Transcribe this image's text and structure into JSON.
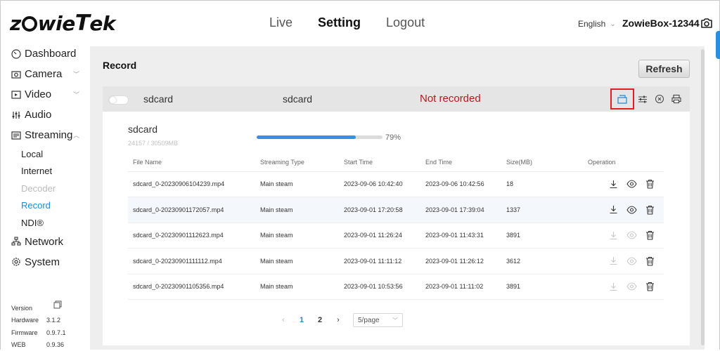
{
  "brand": {
    "logo_text": "ZowieTek"
  },
  "topnav": [
    {
      "label": "Live"
    },
    {
      "label": "Setting"
    },
    {
      "label": "Logout"
    }
  ],
  "header": {
    "language": "English",
    "device_name": "ZowieBox-12344"
  },
  "sidebar": {
    "items": [
      {
        "label": "Dashboard",
        "icon": "dashboard-icon"
      },
      {
        "label": "Camera",
        "icon": "camera-icon"
      },
      {
        "label": "Video",
        "icon": "video-icon"
      },
      {
        "label": "Audio",
        "icon": "audio-icon"
      },
      {
        "label": "Streaming",
        "icon": "streaming-icon"
      }
    ],
    "streaming_sub": [
      {
        "label": "Local"
      },
      {
        "label": "Internet"
      },
      {
        "label": "Decoder"
      },
      {
        "label": "Record"
      },
      {
        "label": "NDI®"
      }
    ],
    "bottom_items": [
      {
        "label": "Network",
        "icon": "network-icon"
      },
      {
        "label": "System",
        "icon": "system-icon"
      }
    ],
    "version": {
      "title": "Version",
      "rows": [
        {
          "key": "Hardware",
          "value": "3.1.2"
        },
        {
          "key": "Firmware",
          "value": "0.9.7.1"
        },
        {
          "key": "WEB",
          "value": "0.9.36"
        }
      ]
    }
  },
  "record": {
    "title": "Record",
    "refresh_label": "Refresh",
    "device": {
      "name": "sdcard",
      "type": "sdcard",
      "status": "Not recorded"
    },
    "storage": {
      "name": "sdcard",
      "capacity": "24157 / 30509MB",
      "percent_label": "79%",
      "percent": 79
    },
    "table": {
      "headers": [
        "File Name",
        "Streaming Type",
        "Start Time",
        "End Time",
        "Size(MB)",
        "Operation"
      ],
      "rows": [
        {
          "file": "sdcard_0-20230906104239.mp4",
          "type": "Main steam",
          "start": "2023-09-06 10:42:40",
          "end": "2023-09-06 10:42:56",
          "size": "18",
          "enabled": true
        },
        {
          "file": "sdcard_0-20230901172057.mp4",
          "type": "Main steam",
          "start": "2023-09-01 17:20:58",
          "end": "2023-09-01 17:39:04",
          "size": "1337",
          "enabled": true
        },
        {
          "file": "sdcard_0-20230901112623.mp4",
          "type": "Main steam",
          "start": "2023-09-01 11:26:24",
          "end": "2023-09-01 11:43:31",
          "size": "3891",
          "enabled": false
        },
        {
          "file": "sdcard_0-20230901111112.mp4",
          "type": "Main steam",
          "start": "2023-09-01 11:11:12",
          "end": "2023-09-01 11:26:12",
          "size": "3612",
          "enabled": false
        },
        {
          "file": "sdcard_0-20230901105356.mp4",
          "type": "Main steam",
          "start": "2023-09-01 10:53:56",
          "end": "2023-09-01 11:11:02",
          "size": "3891",
          "enabled": false
        }
      ]
    },
    "pagination": {
      "prev": "‹",
      "pages": [
        "1",
        "2"
      ],
      "next": "›",
      "page_size": "5/page"
    }
  },
  "colors": {
    "accent": "#1d8bd8",
    "status_error": "#b51a1a",
    "highlight_box": "#e02020",
    "progress": "#3a8ee6"
  }
}
